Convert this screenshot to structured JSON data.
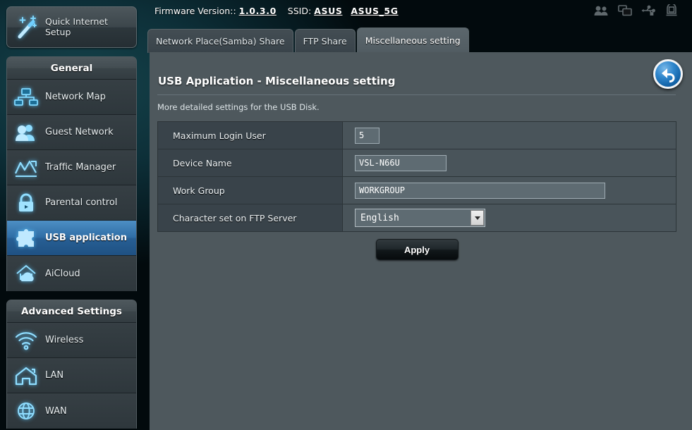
{
  "header": {
    "firmware_label": "Firmware Version::",
    "firmware_value": "1.0.3.0",
    "ssid_label": "SSID:",
    "ssid_primary": "ASUS",
    "ssid_secondary": "ASUS_5G",
    "icons": [
      "guest-users-icon",
      "screens-icon",
      "usb-icon",
      "printer-icon"
    ]
  },
  "sidebar": {
    "quick_setup_label": "Quick Internet Setup",
    "general_header": "General",
    "general_items": [
      {
        "label": "Network Map",
        "icon": "network-map-icon",
        "active": false
      },
      {
        "label": "Guest Network",
        "icon": "guest-network-icon",
        "active": false
      },
      {
        "label": "Traffic Manager",
        "icon": "traffic-manager-icon",
        "active": false
      },
      {
        "label": "Parental control",
        "icon": "lock-icon",
        "active": false
      },
      {
        "label": "USB application",
        "icon": "puzzle-icon",
        "active": true
      },
      {
        "label": "AiCloud",
        "icon": "cloud-icon",
        "active": false
      }
    ],
    "advanced_header": "Advanced Settings",
    "advanced_items": [
      {
        "label": "Wireless",
        "icon": "wifi-icon"
      },
      {
        "label": "LAN",
        "icon": "house-icon"
      },
      {
        "label": "WAN",
        "icon": "globe-icon"
      }
    ]
  },
  "tabs": [
    {
      "label": "Network Place(Samba) Share",
      "active": false
    },
    {
      "label": "FTP Share",
      "active": false
    },
    {
      "label": "Miscellaneous setting",
      "active": true
    }
  ],
  "panel": {
    "title": "USB Application - Miscellaneous setting",
    "subtitle": "More detailed settings for the USB Disk.",
    "back_icon": "back-arrow-icon",
    "rows": [
      {
        "label": "Maximum Login User",
        "type": "text",
        "value": "5",
        "size": "w-tiny"
      },
      {
        "label": "Device Name",
        "type": "text",
        "value": "VSL-N66U",
        "size": "w-mid"
      },
      {
        "label": "Work Group",
        "type": "text",
        "value": "WORKGROUP",
        "size": "w-wide"
      },
      {
        "label": "Character set on FTP Server",
        "type": "select",
        "value": "English"
      }
    ],
    "apply_label": "Apply"
  },
  "colors": {
    "accent_blue": "#3b7fb4",
    "icon_glow": "#5ac8ff",
    "panel_bg": "#4e585d",
    "label_bg": "#39434a"
  }
}
